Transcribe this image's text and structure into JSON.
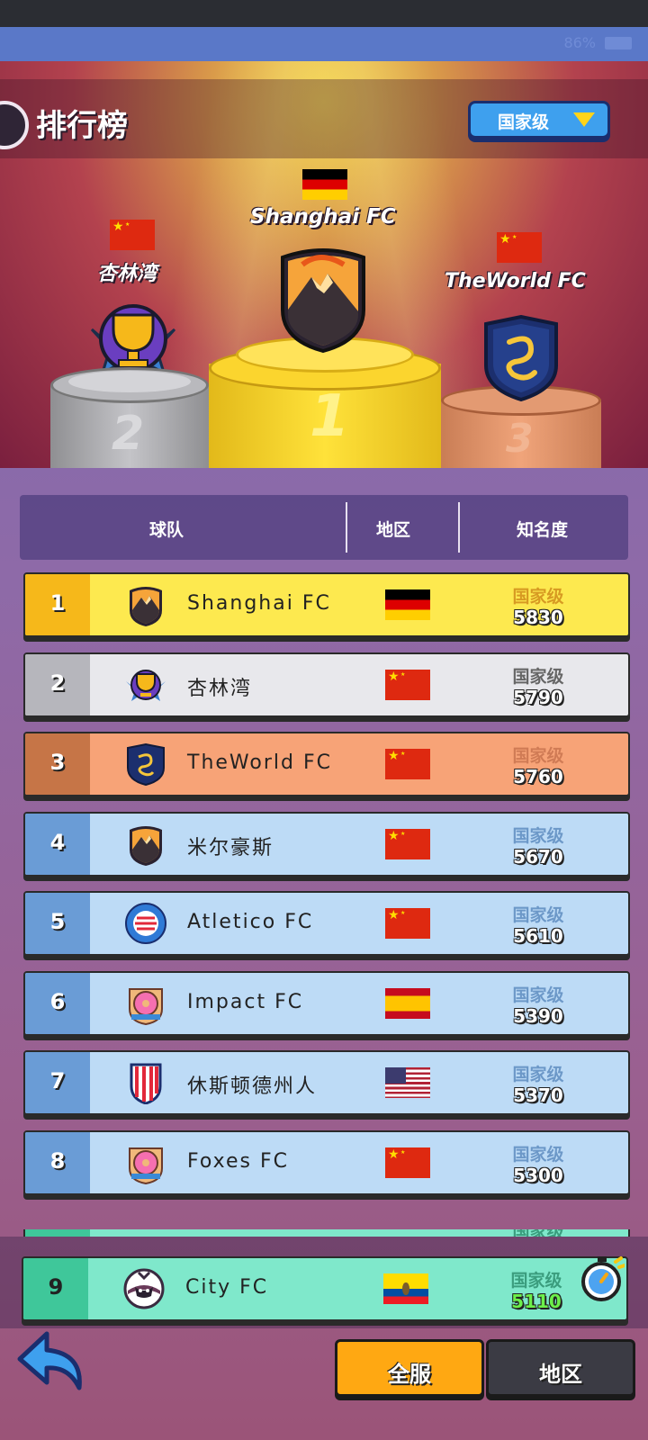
{
  "status": {
    "battery": "86%"
  },
  "header": {
    "title": "排行榜",
    "tier_dropdown": "国家级"
  },
  "podium": [
    {
      "place": "2",
      "name": "杏林湾",
      "flag": "cn"
    },
    {
      "place": "1",
      "name": "Shanghai FC",
      "flag": "de"
    },
    {
      "place": "3",
      "name": "TheWorld FC",
      "flag": "cn"
    }
  ],
  "columns": {
    "team": "球队",
    "region": "地区",
    "fame": "知名度"
  },
  "rows": [
    {
      "rank": "1",
      "name": "Shanghai FC",
      "flag": "de",
      "tier": "国家级",
      "fame": "5830",
      "icon": "volcano-crest-icon"
    },
    {
      "rank": "2",
      "name": "杏林湾",
      "flag": "cn",
      "tier": "国家级",
      "fame": "5790",
      "icon": "trophy-crest-icon"
    },
    {
      "rank": "3",
      "name": "TheWorld FC",
      "flag": "cn",
      "tier": "国家级",
      "fame": "5760",
      "icon": "dragon-crest-icon"
    },
    {
      "rank": "4",
      "name": "米尔豪斯",
      "flag": "cn",
      "tier": "国家级",
      "fame": "5670",
      "icon": "volcano-crest-icon"
    },
    {
      "rank": "5",
      "name": "Atletico FC",
      "flag": "cn",
      "tier": "国家级",
      "fame": "5610",
      "icon": "striped-circle-crest-icon"
    },
    {
      "rank": "6",
      "name": "Impact FC",
      "flag": "es",
      "tier": "国家级",
      "fame": "5390",
      "icon": "donut-crest-icon"
    },
    {
      "rank": "7",
      "name": "休斯顿德州人",
      "flag": "us",
      "tier": "国家级",
      "fame": "5370",
      "icon": "striped-shield-crest-icon"
    },
    {
      "rank": "8",
      "name": "Foxes FC",
      "flag": "cn",
      "tier": "国家级",
      "fame": "5300",
      "icon": "donut-crest-icon"
    }
  ],
  "partial_row": {
    "tier": "国家级"
  },
  "my_team": {
    "rank": "9",
    "name": "City FC",
    "flag": "ec",
    "tier": "国家级",
    "fame": "5110",
    "icon": "badger-crest-icon"
  },
  "tabs": {
    "server": "全服",
    "region": "地区"
  }
}
